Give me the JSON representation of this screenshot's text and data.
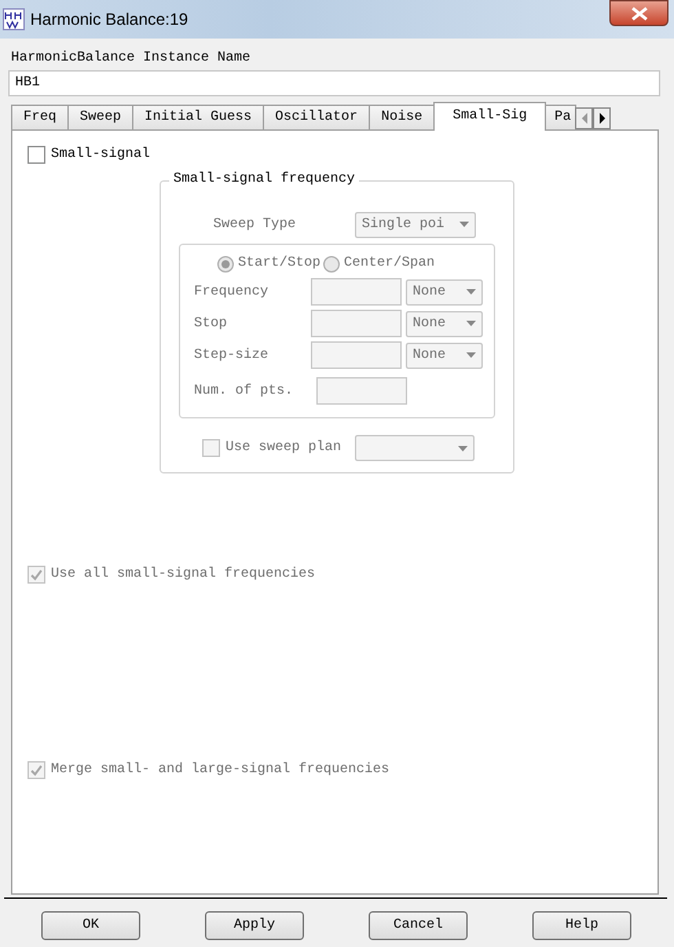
{
  "window": {
    "title": "Harmonic Balance:19"
  },
  "instance_name": {
    "label": "HarmonicBalance Instance Name",
    "value": "HB1"
  },
  "tabs": [
    {
      "label": "Freq",
      "selected": false
    },
    {
      "label": "Sweep",
      "selected": false
    },
    {
      "label": "Initial Guess",
      "selected": false
    },
    {
      "label": "Oscillator",
      "selected": false
    },
    {
      "label": "Noise",
      "selected": false
    },
    {
      "label": "Small-Sig",
      "selected": true
    },
    {
      "label": "Pa",
      "selected": false
    }
  ],
  "small_signal": {
    "label": "Small-signal",
    "checked": false
  },
  "group": {
    "title": "Small-signal frequency",
    "disabled": true,
    "sweep_type": {
      "label": "Sweep Type",
      "value": "Single poi"
    },
    "modes": [
      {
        "label": "Start/Stop",
        "selected": true
      },
      {
        "label": "Center/Span",
        "selected": false
      }
    ],
    "fields": [
      {
        "label": "Frequency",
        "unit": "None"
      },
      {
        "label": "Stop",
        "unit": "None"
      },
      {
        "label": "Step-size",
        "unit": "None"
      },
      {
        "label": "Num. of pts."
      }
    ],
    "sweep_plan": {
      "label": "Use sweep plan",
      "checked": false
    }
  },
  "options": [
    {
      "label": "Use all small-signal frequencies",
      "checked": true,
      "disabled": true
    },
    {
      "label": "Merge small- and large-signal frequencies",
      "checked": true,
      "disabled": true
    }
  ],
  "buttons": [
    "OK",
    "Apply",
    "Cancel",
    "Help"
  ]
}
